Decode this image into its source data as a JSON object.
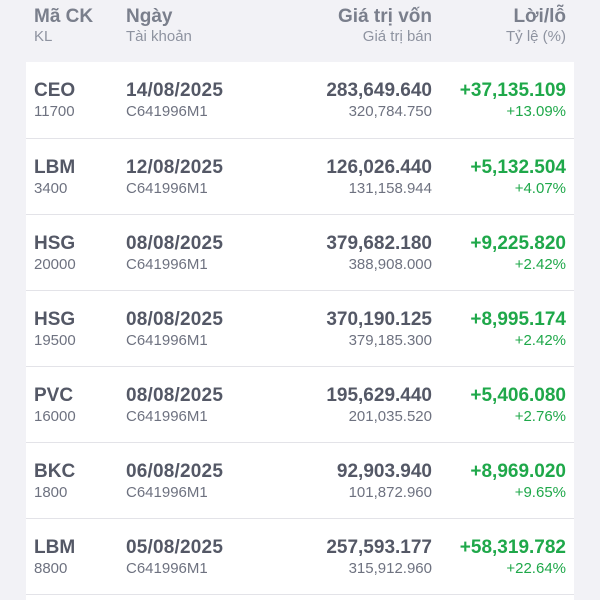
{
  "header": {
    "col1_title": "Mã CK",
    "col1_sub": "KL",
    "col2_title": "Ngày",
    "col2_sub": "Tài khoản",
    "col3_title": "Giá trị vốn",
    "col3_sub": "Giá trị bán",
    "col4_title": "Lời/lỗ",
    "col4_sub": "Tỷ lệ (%)"
  },
  "rows": [
    {
      "symbol": "CEO",
      "qty": "11700",
      "date": "14/08/2025",
      "account": "C641996M1",
      "cost": "283,649.640",
      "sell_value": "320,784.750",
      "pl": "+37,135.109",
      "pct": "+13.09%"
    },
    {
      "symbol": "LBM",
      "qty": "3400",
      "date": "12/08/2025",
      "account": "C641996M1",
      "cost": "126,026.440",
      "sell_value": "131,158.944",
      "pl": "+5,132.504",
      "pct": "+4.07%"
    },
    {
      "symbol": "HSG",
      "qty": "20000",
      "date": "08/08/2025",
      "account": "C641996M1",
      "cost": "379,682.180",
      "sell_value": "388,908.000",
      "pl": "+9,225.820",
      "pct": "+2.42%"
    },
    {
      "symbol": "HSG",
      "qty": "19500",
      "date": "08/08/2025",
      "account": "C641996M1",
      "cost": "370,190.125",
      "sell_value": "379,185.300",
      "pl": "+8,995.174",
      "pct": "+2.42%"
    },
    {
      "symbol": "PVC",
      "qty": "16000",
      "date": "08/08/2025",
      "account": "C641996M1",
      "cost": "195,629.440",
      "sell_value": "201,035.520",
      "pl": "+5,406.080",
      "pct": "+2.76%"
    },
    {
      "symbol": "BKC",
      "qty": "1800",
      "date": "06/08/2025",
      "account": "C641996M1",
      "cost": "92,903.940",
      "sell_value": "101,872.960",
      "pl": "+8,969.020",
      "pct": "+9.65%"
    },
    {
      "symbol": "LBM",
      "qty": "8800",
      "date": "05/08/2025",
      "account": "C641996M1",
      "cost": "257,593.177",
      "sell_value": "315,912.960",
      "pl": "+58,319.782",
      "pct": "+22.64%"
    }
  ],
  "colors": {
    "positive": "#1fa84a",
    "background": "#f2f2f6",
    "card": "#ffffff"
  }
}
